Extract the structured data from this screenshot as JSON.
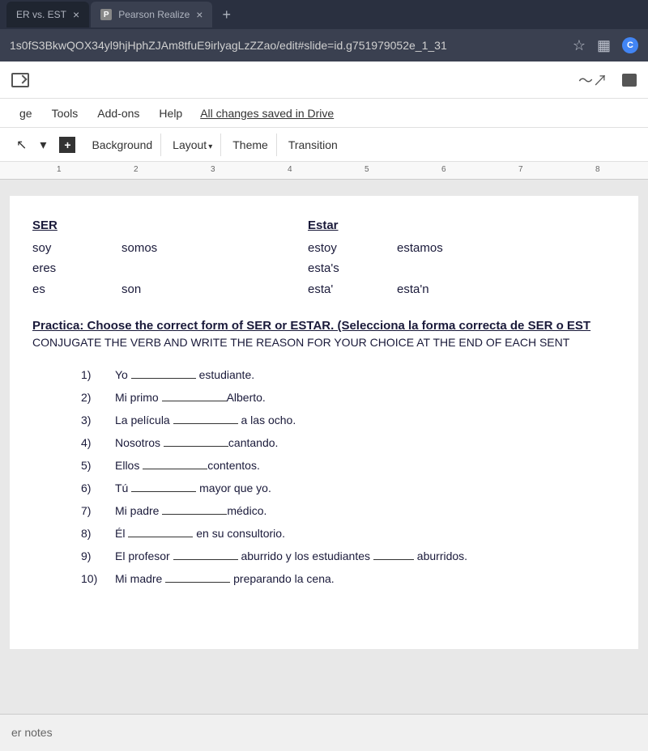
{
  "tabs": [
    {
      "label": "ER vs. EST",
      "active": false
    },
    {
      "label": "Pearson Realize",
      "active": true,
      "icon": "P"
    }
  ],
  "url": "1s0fS3BkwQOX34yl9hjHphZJAm8tfuE9irlyagLzZZao/edit#slide=id.g751979052e_1_31",
  "ext_letter": "C",
  "menu": {
    "items": [
      "ge",
      "Tools",
      "Add-ons",
      "Help"
    ],
    "status": "All changes saved in Drive"
  },
  "toolbar": {
    "background": "Background",
    "layout": "Layout",
    "theme": "Theme",
    "transition": "Transition"
  },
  "ruler_marks": [
    "1",
    "2",
    "3",
    "4",
    "5",
    "6",
    "7",
    "8"
  ],
  "slide": {
    "ser": {
      "header": "SER",
      "rows": [
        [
          "soy",
          "somos"
        ],
        [
          "eres",
          ""
        ],
        [
          "es",
          "son"
        ]
      ]
    },
    "estar": {
      "header": "Estar",
      "rows": [
        [
          "estoy",
          "estamos"
        ],
        [
          "esta's",
          ""
        ],
        [
          "esta'",
          "esta'n"
        ]
      ]
    },
    "practica_title": "Practica: Choose the correct form of SER or ESTAR. (Selecciona la forma correcta de SER o EST",
    "practica_sub": "CONJUGATE THE VERB AND WRITE THE REASON FOR YOUR CHOICE AT THE END OF EACH SENT",
    "exercises": [
      {
        "num": "1)",
        "pre": "Yo ",
        "post": " estudiante."
      },
      {
        "num": "2)",
        "pre": "Mi primo ",
        "post": "Alberto."
      },
      {
        "num": "3)",
        "pre": "La película ",
        "post": " a las ocho."
      },
      {
        "num": "4)",
        "pre": "Nosotros ",
        "post": "cantando."
      },
      {
        "num": "5)",
        "pre": "Ellos ",
        "post": "contentos."
      },
      {
        "num": "6)",
        "pre": "Tú ",
        "post": " mayor que yo."
      },
      {
        "num": "7)",
        "pre": "Mi padre ",
        "post": "médico."
      },
      {
        "num": "8)",
        "pre": "Él ",
        "post": " en su consultorio."
      },
      {
        "num": "9)",
        "pre": "El profesor ",
        "post": " aburrido y los estudiantes ",
        "post2": " aburridos."
      },
      {
        "num": "10)",
        "pre": "Mi madre ",
        "post": " preparando la cena."
      }
    ]
  },
  "notes_label": "er notes"
}
